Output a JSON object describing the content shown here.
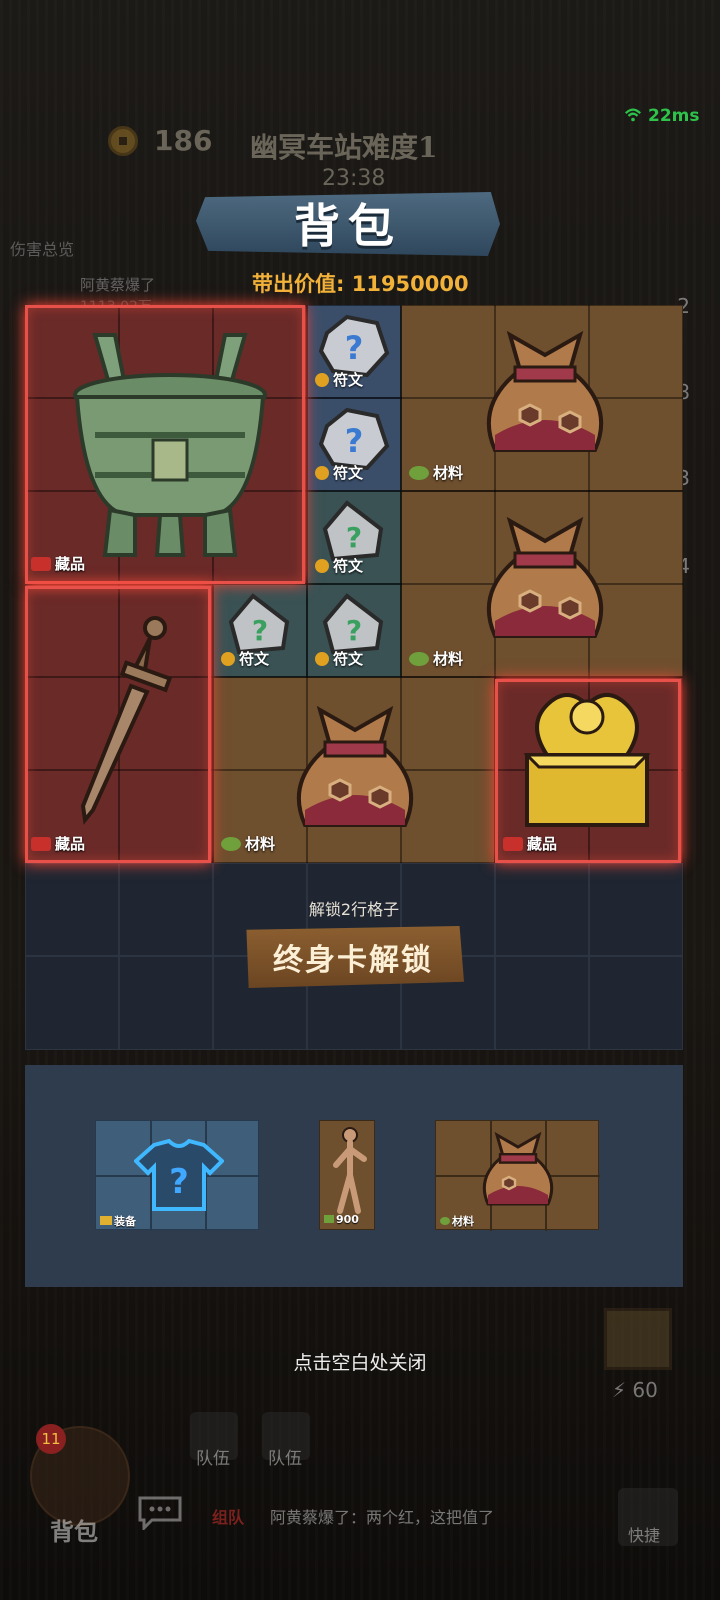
{
  "hud": {
    "coins": "186",
    "stage_title": "幽冥车站难度1",
    "timer": "23:38",
    "ping": "22ms",
    "damage_overview": "伤害总览",
    "kill_message": "阿黄蔡爆了",
    "kill_sub": "1113.02万",
    "side_numbers": [
      "2",
      "8",
      "3",
      "4"
    ]
  },
  "backpack": {
    "title": "背包",
    "carry_value_label": "带出价值:",
    "carry_value": "11950000",
    "items": [
      {
        "name": "bronze-cauldron",
        "tag": "藏品"
      },
      {
        "name": "rune-1",
        "tag": "符文"
      },
      {
        "name": "rune-2",
        "tag": "符文"
      },
      {
        "name": "rune-3",
        "tag": "符文"
      },
      {
        "name": "rune-4",
        "tag": "符文"
      },
      {
        "name": "rune-5",
        "tag": "符文"
      },
      {
        "name": "material-bag-1",
        "tag": "材料"
      },
      {
        "name": "material-bag-2",
        "tag": "材料"
      },
      {
        "name": "bronze-sword",
        "tag": "藏品"
      },
      {
        "name": "material-bag-3",
        "tag": "材料"
      },
      {
        "name": "golden-seal",
        "tag": "藏品"
      }
    ],
    "unlock_text": "解锁2行格子",
    "unlock_button": "终身卡解锁"
  },
  "equipment": {
    "slots": [
      {
        "name": "armor",
        "tag": "装备"
      },
      {
        "name": "mannequin",
        "tag": "900"
      },
      {
        "name": "material-bag",
        "tag": "材料"
      }
    ]
  },
  "close_hint": "点击空白处关闭",
  "bottom": {
    "bag_badge": "11",
    "bag_label": "背包",
    "team_label_1": "队伍",
    "team_label_2": "队伍",
    "chat_channel": "组队",
    "chat_message": "阿黄蔡爆了：两个红，这把值了",
    "quick_label": "快捷",
    "energy": "60"
  },
  "colors": {
    "accent_gold": "#f2b23a",
    "collectible_red": "#e8514a",
    "cell_brown": "#6e4f2e",
    "cell_teal": "#3a5254",
    "cell_blue": "#3a4e6a",
    "locked_cell": "#1f2631"
  }
}
